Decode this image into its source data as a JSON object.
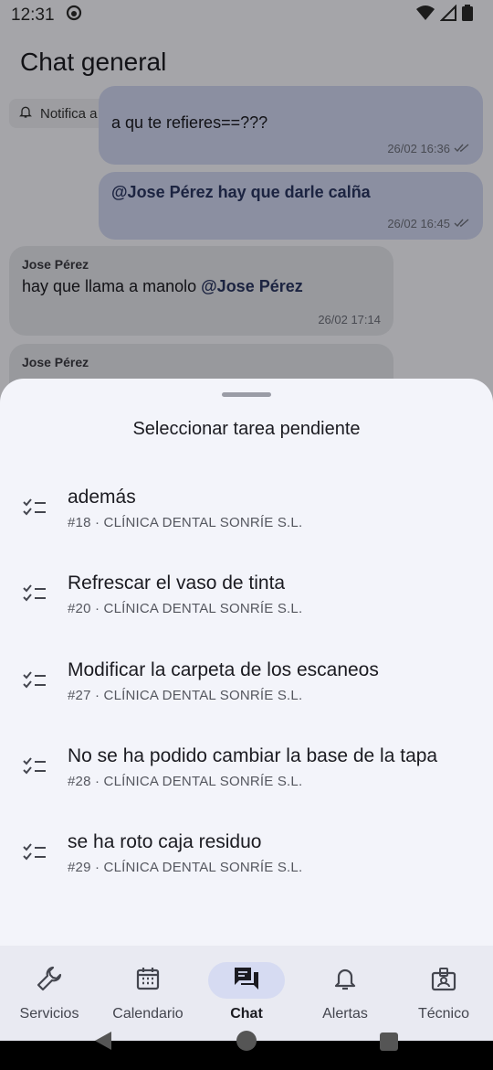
{
  "status_bar": {
    "time": "12:31"
  },
  "app_bar": {
    "title": "Chat general"
  },
  "notify_chip": {
    "label": "Notifica a"
  },
  "chat": {
    "messages": [
      {
        "text": "a qu te refieres==???",
        "time": "26/02 16:36"
      },
      {
        "mention": "@Jose Pérez",
        "text": " hay que darle calña",
        "time": "26/02 16:45"
      },
      {
        "author": "Jose Pérez",
        "text": "hay que llama a manolo ",
        "mention": "@Jose Pérez",
        "time": "26/02 17:14"
      },
      {
        "author": "Jose Pérez"
      }
    ]
  },
  "sheet": {
    "title": "Seleccionar tarea pendiente",
    "tasks": [
      {
        "name": "además",
        "sub": "#18 · CLÍNICA DENTAL SONRÍE S.L."
      },
      {
        "name": "Refrescar el vaso de tinta",
        "sub": "#20 · CLÍNICA DENTAL SONRÍE S.L."
      },
      {
        "name": "Modificar la carpeta de los escaneos",
        "sub": "#27 · CLÍNICA DENTAL SONRÍE S.L."
      },
      {
        "name": "No se ha podido cambiar la base de la tapa",
        "sub": "#28 · CLÍNICA DENTAL SONRÍE S.L."
      },
      {
        "name": "se ha roto caja residuo",
        "sub": "#29 · CLÍNICA DENTAL SONRÍE S.L."
      }
    ]
  },
  "nav": {
    "items": [
      {
        "label": "Servicios",
        "icon": "wrench-icon"
      },
      {
        "label": "Calendario",
        "icon": "calendar-icon"
      },
      {
        "label": "Chat",
        "icon": "chat-icon",
        "active": true
      },
      {
        "label": "Alertas",
        "icon": "bell-icon"
      },
      {
        "label": "Técnico",
        "icon": "badge-icon"
      }
    ]
  },
  "colors": {
    "accent": "#d6dbf2",
    "bubble_me": "#cdd3ee",
    "bubble_other": "#e1e2e8",
    "sheet": "#f3f4fa"
  }
}
